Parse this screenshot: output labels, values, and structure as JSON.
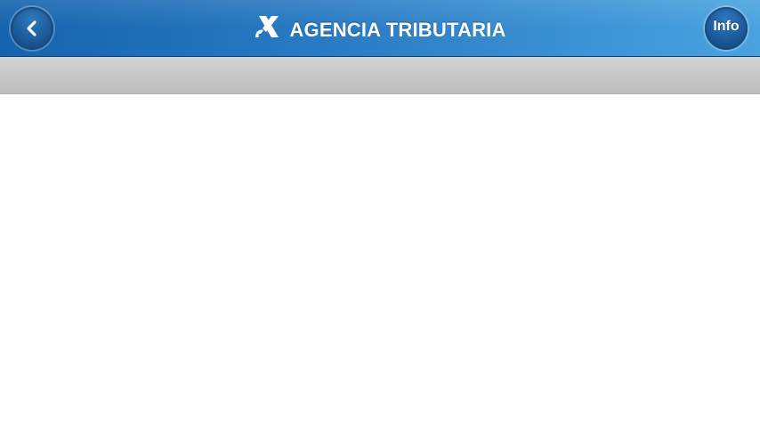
{
  "header": {
    "title": "AGENCIA TRIBUTARIA",
    "back_icon": "chevron-left-icon",
    "logo_icon": "agencia-tributaria-logo-icon",
    "info_label": "Info",
    "colors": {
      "gradient_start": "#1563ad",
      "gradient_end": "#4aa3de",
      "button": "#1c5a9a"
    }
  },
  "subbar": {
    "color": "#c8c8c8"
  },
  "content": {
    "background": "#ffffff"
  }
}
